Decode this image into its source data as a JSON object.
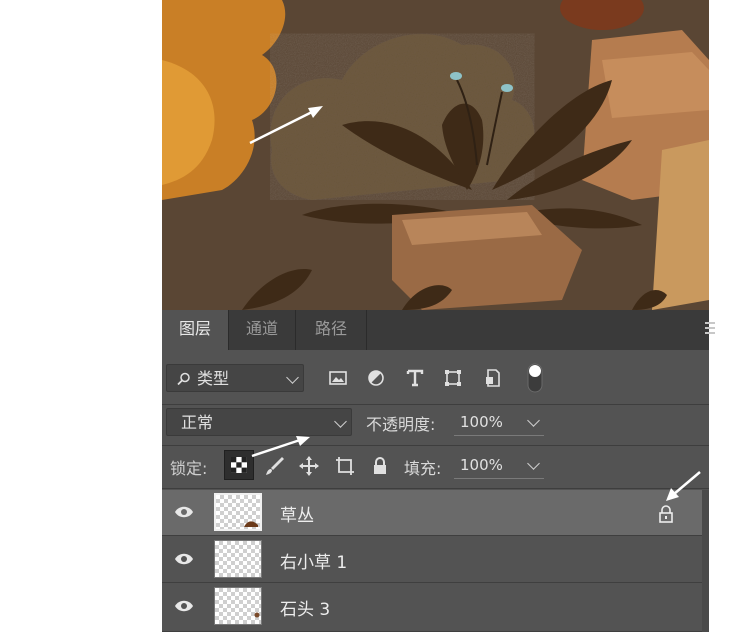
{
  "colors": {
    "panel_bg": "#535353",
    "tabbar_bg": "#3a3a3a",
    "selected_layer": "#6a6a6a",
    "arrow": "#ffffff"
  },
  "tabs": [
    {
      "label": "图层",
      "active": true
    },
    {
      "label": "通道",
      "active": false
    },
    {
      "label": "路径",
      "active": false
    }
  ],
  "filter": {
    "kind_label": "类型",
    "icons": [
      "image-filter-icon",
      "adjustment-filter-icon",
      "text-filter-icon",
      "shape-filter-icon",
      "smart-object-filter-icon",
      "filter-toggle"
    ]
  },
  "blend": {
    "mode": "正常",
    "opacity_label": "不透明度:",
    "opacity_value": "100%"
  },
  "lock": {
    "label": "锁定:",
    "icons": [
      "lock-transparent-pixels-icon",
      "lock-image-pixels-icon",
      "lock-position-icon",
      "lock-artboard-icon",
      "lock-all-icon"
    ],
    "fill_label": "填充:",
    "fill_value": "100%"
  },
  "layers": [
    {
      "name": "草丛",
      "visible": true,
      "selected": true,
      "locked": true
    },
    {
      "name": "右小草 1",
      "visible": true,
      "selected": false,
      "locked": false
    },
    {
      "name": "石头 3",
      "visible": true,
      "selected": false,
      "locked": false
    }
  ]
}
